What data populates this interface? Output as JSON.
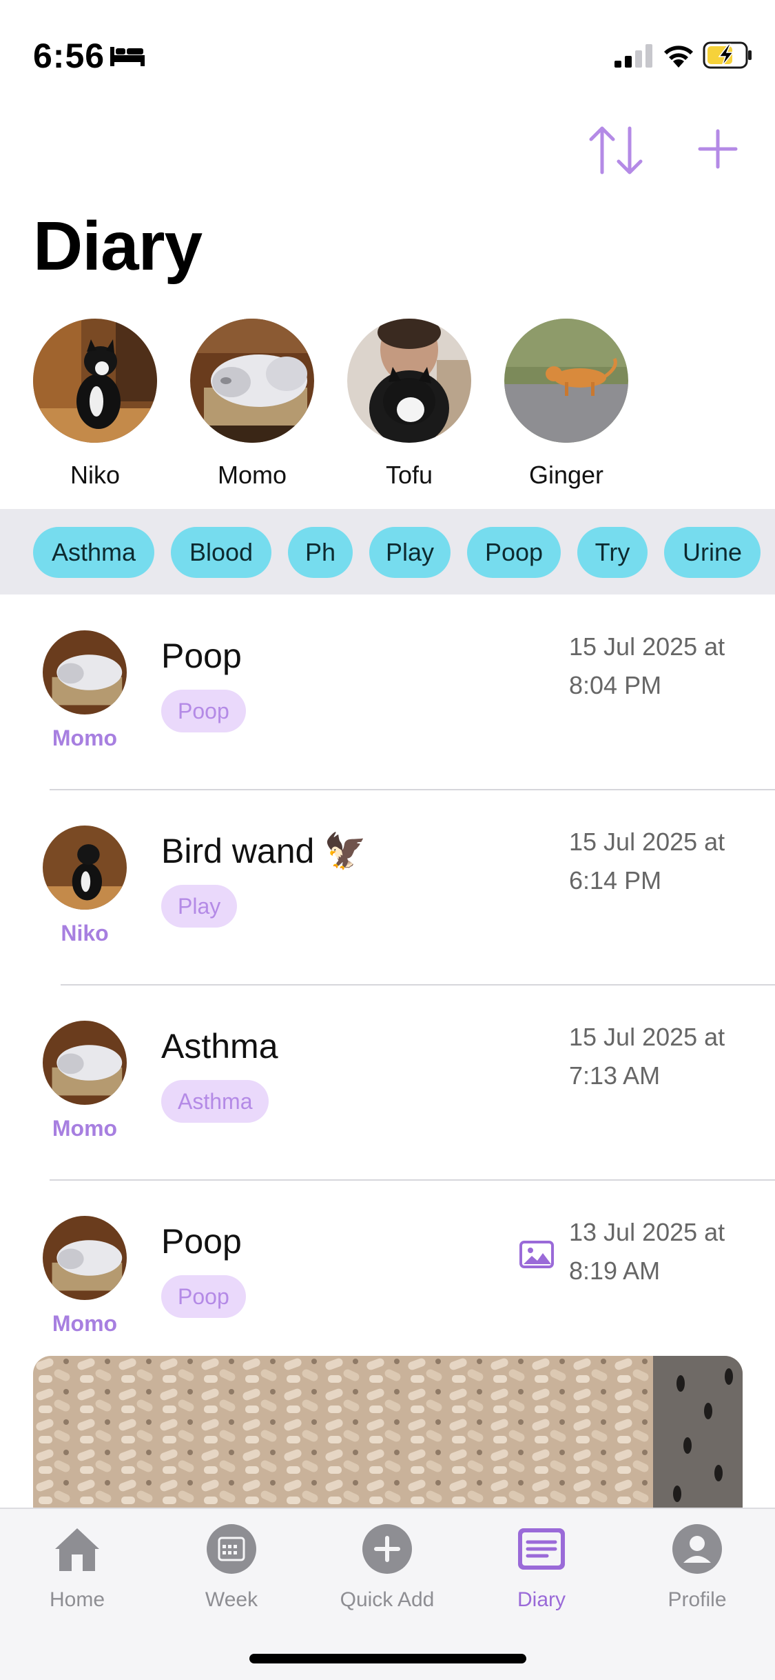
{
  "status_bar": {
    "time": "6:56",
    "icons": [
      "bed-icon",
      "signal-icon",
      "wifi-icon",
      "battery-charging-icon"
    ]
  },
  "header": {
    "title": "Diary",
    "actions": [
      "sort-icon",
      "plus-icon"
    ]
  },
  "pets": [
    {
      "name": "Niko"
    },
    {
      "name": "Momo"
    },
    {
      "name": "Tofu"
    },
    {
      "name": "Ginger"
    }
  ],
  "tags": [
    "Asthma",
    "Blood",
    "Ph",
    "Play",
    "Poop",
    "Try",
    "Urine"
  ],
  "entries": [
    {
      "pet": "Momo",
      "title": "Poop",
      "tag": "Poop",
      "date_line1": "15 Jul 2025 at",
      "date_line2": "8:04 PM",
      "has_photo": false
    },
    {
      "pet": "Niko",
      "title": "Bird wand 🦅",
      "tag": "Play",
      "date_line1": "15 Jul 2025 at",
      "date_line2": "6:14 PM",
      "has_photo": false
    },
    {
      "pet": "Momo",
      "title": "Asthma",
      "tag": "Asthma",
      "date_line1": "15 Jul 2025 at",
      "date_line2": "7:13 AM",
      "has_photo": false
    },
    {
      "pet": "Momo",
      "title": "Poop",
      "tag": "Poop",
      "date_line1": "13 Jul 2025 at",
      "date_line2": "8:19 AM",
      "has_photo": true
    }
  ],
  "tab_bar": {
    "tabs": [
      {
        "label": "Home",
        "icon": "home-icon",
        "active": false
      },
      {
        "label": "Week",
        "icon": "calendar-icon",
        "active": false
      },
      {
        "label": "Quick Add",
        "icon": "plus-circle-icon",
        "active": false
      },
      {
        "label": "Diary",
        "icon": "diary-icon",
        "active": true
      },
      {
        "label": "Profile",
        "icon": "person-icon",
        "active": false
      }
    ]
  },
  "colors": {
    "accent": "#a77fe0",
    "tag_chip": "#76dcee",
    "entry_tag_bg": "#ead9fb",
    "inactive_tab": "#8e8e93"
  }
}
